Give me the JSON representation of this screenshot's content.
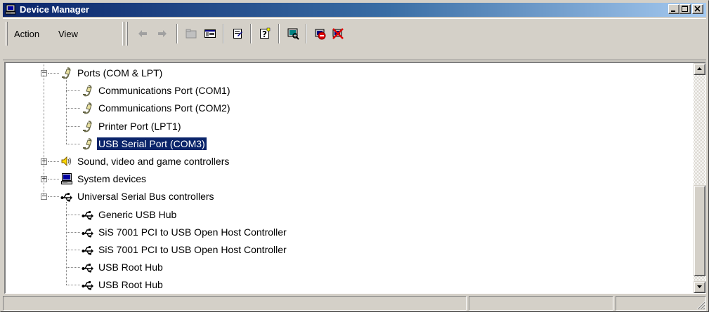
{
  "window": {
    "title": "Device Manager",
    "colors": {
      "titlebar_start": "#0a246a",
      "titlebar_end": "#a6caf0",
      "face": "#d4d0c8",
      "selection": "#0a246a"
    }
  },
  "title_buttons": [
    {
      "name": "minimize",
      "icon": "minimize-icon"
    },
    {
      "name": "maximize",
      "icon": "maximize-icon"
    },
    {
      "name": "close",
      "icon": "close-icon"
    }
  ],
  "menu": {
    "action_label": "Action",
    "view_label": "View"
  },
  "toolbar": [
    {
      "name": "back",
      "icon": "back-arrow-icon"
    },
    {
      "name": "forward",
      "icon": "forward-arrow-icon"
    },
    {
      "name": "up",
      "icon": "up-folder-icon"
    },
    {
      "name": "show-hide-console-tree",
      "icon": "console-tree-icon"
    },
    {
      "name": "properties",
      "icon": "properties-icon"
    },
    {
      "name": "help",
      "icon": "help-icon"
    },
    {
      "name": "scan-hardware",
      "icon": "scan-hardware-icon"
    },
    {
      "name": "disable",
      "icon": "disable-device-icon"
    },
    {
      "name": "uninstall",
      "icon": "uninstall-icon"
    }
  ],
  "tree": {
    "rows": [
      {
        "label": "Ports (COM & LPT)",
        "icon": "port-icon",
        "level": 1,
        "expanded": true
      },
      {
        "label": "Communications Port (COM1)",
        "icon": "port-icon",
        "level": 2
      },
      {
        "label": "Communications Port (COM2)",
        "icon": "port-icon",
        "level": 2
      },
      {
        "label": "Printer Port (LPT1)",
        "icon": "port-icon",
        "level": 2
      },
      {
        "label": "USB Serial Port (COM3)",
        "icon": "port-icon",
        "level": 2,
        "selected": true
      },
      {
        "label": "Sound, video and game controllers",
        "icon": "speaker-icon",
        "level": 1,
        "expanded": false
      },
      {
        "label": "System devices",
        "icon": "computer-icon",
        "level": 1,
        "expanded": false
      },
      {
        "label": "Universal Serial Bus controllers",
        "icon": "usb-icon",
        "level": 1,
        "expanded": true
      },
      {
        "label": "Generic USB Hub",
        "icon": "usb-icon",
        "level": 2
      },
      {
        "label": "SiS 7001 PCI to USB Open Host Controller",
        "icon": "usb-icon",
        "level": 2
      },
      {
        "label": "SiS 7001 PCI to USB Open Host Controller",
        "icon": "usb-icon",
        "level": 2
      },
      {
        "label": "USB Root Hub",
        "icon": "usb-icon",
        "level": 2
      },
      {
        "label": "USB Root Hub",
        "icon": "usb-icon",
        "level": 2
      }
    ]
  },
  "statusbar": {
    "panels": [
      "",
      "",
      ""
    ]
  }
}
